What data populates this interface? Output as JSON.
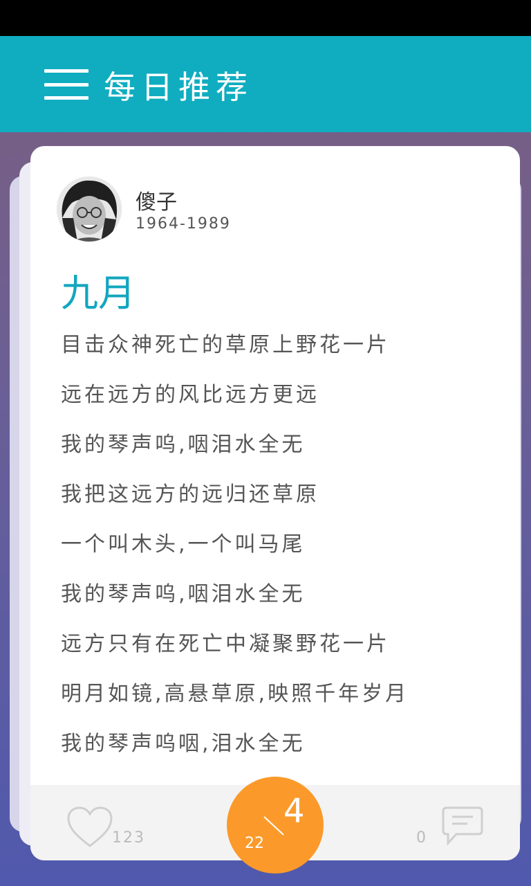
{
  "header": {
    "title": "每日推荐",
    "menu_icon": "hamburger-menu-icon"
  },
  "author": {
    "name": "傻子",
    "years": "1964-1989",
    "avatar": "author-avatar"
  },
  "poem": {
    "title": "九月",
    "lines": [
      "目击众神死亡的草原上野花一片",
      "远在远方的风比远方更远",
      "我的琴声呜,咽泪水全无",
      "我把这远方的远归还草原",
      "一个叫木头,一个叫马尾",
      "我的琴声呜,咽泪水全无",
      "远方只有在死亡中凝聚野花一片",
      "明月如镜,高悬草原,映照千年岁月",
      "我的琴声呜咽,泪水全无"
    ]
  },
  "footer": {
    "like_icon": "heart-icon",
    "like_count": "123",
    "comment_icon": "comment-icon",
    "comment_count": "0"
  },
  "date": {
    "day": "4",
    "month": "22"
  },
  "colors": {
    "accent": "#10adc0",
    "title": "#12a6bf",
    "badge": "#fb9a2a"
  }
}
